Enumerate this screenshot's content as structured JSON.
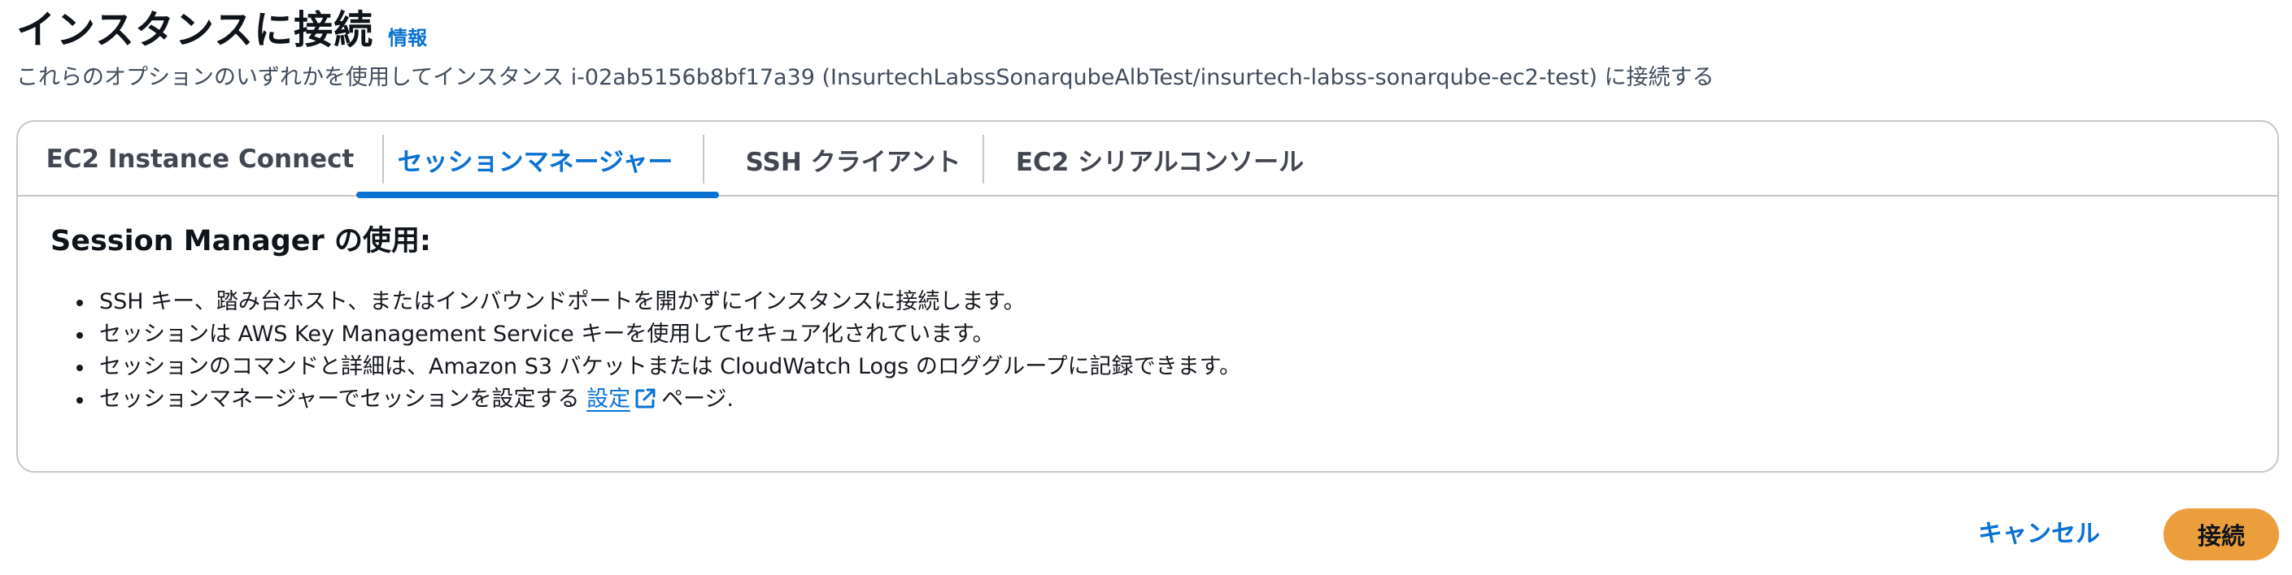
{
  "header": {
    "title": "インスタンスに接続",
    "info_link": "情報",
    "subtitle": "これらのオプションのいずれかを使用してインスタンス i-02ab5156b8bf17a39 (InsurtechLabssSonarqubeAlbTest/insurtech-labss-sonarqube-ec2-test) に接続する"
  },
  "tabs": [
    {
      "label": "EC2 Instance Connect",
      "active": false
    },
    {
      "label": "セッションマネージャー",
      "active": true
    },
    {
      "label": "SSH クライアント",
      "active": false
    },
    {
      "label": "EC2 シリアルコンソール",
      "active": false
    }
  ],
  "panel": {
    "heading": "Session Manager の使用:",
    "bullets": [
      "SSH キー、踏み台ホスト、またはインバウンドポートを開かずにインスタンスに接続します。",
      "セッションは AWS Key Management Service キーを使用してセキュア化されています。",
      "セッションのコマンドと詳細は、Amazon S3 バケットまたは CloudWatch Logs のロググループに記録できます。"
    ],
    "last_bullet": {
      "prefix": "セッションマネージャーでセッションを設定する ",
      "link": "設定",
      "suffix": "ページ."
    }
  },
  "actions": {
    "cancel_label": "キャンセル",
    "connect_label": "接続"
  },
  "icons": {
    "external_link": "external-link-icon"
  },
  "colors": {
    "accent": "#0972d3",
    "primary_button": "#ec9d3c",
    "border": "#c6c6cd"
  }
}
